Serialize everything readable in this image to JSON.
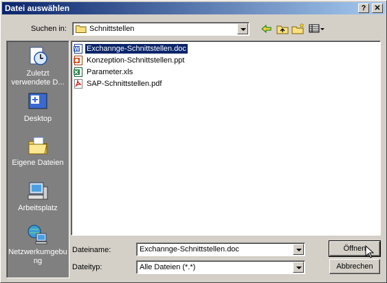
{
  "window": {
    "title": "Datei auswählen",
    "help_button": "?",
    "close_button": "✕"
  },
  "toolbar": {
    "look_in_label": "Suchen in:",
    "look_in_value": "Schnittstellen"
  },
  "places": [
    {
      "label": "Zuletzt verwendete D...",
      "icon": "recent-documents-icon"
    },
    {
      "label": "Desktop",
      "icon": "desktop-icon"
    },
    {
      "label": "Eigene Dateien",
      "icon": "my-documents-icon"
    },
    {
      "label": "Arbeitsplatz",
      "icon": "my-computer-icon"
    },
    {
      "label": "Netzwerkumgebung",
      "icon": "network-icon"
    }
  ],
  "files": [
    {
      "name": "Exchannge-Schnittstellen.doc",
      "icon": "word-doc-icon",
      "selected": true
    },
    {
      "name": "Konzeption-Schnittstellen.ppt",
      "icon": "powerpoint-icon",
      "selected": false
    },
    {
      "name": "Parameter.xls",
      "icon": "excel-icon",
      "selected": false
    },
    {
      "name": "SAP-Schnittstellen.pdf",
      "icon": "pdf-icon",
      "selected": false
    }
  ],
  "bottom": {
    "filename_label": "Dateiname:",
    "filename_value": "Exchannge-Schnittstellen.doc",
    "filetype_label": "Dateityp:",
    "filetype_value": "Alle Dateien (*.*)",
    "open_button": "Öffnen",
    "cancel_button": "Abbrechen"
  }
}
